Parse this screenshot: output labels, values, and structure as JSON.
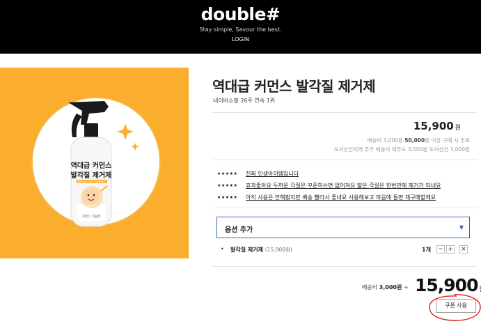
{
  "header": {
    "logo": "double#",
    "tagline": "Stay simple, Savour the best.",
    "login": "LOGIN"
  },
  "product": {
    "title": "역대급 커먼스 발각질 제거제",
    "subtitle": "네이버쇼핑 26주 연속 1위",
    "price": "15,900",
    "currency": "원",
    "image": {
      "bottle_label_line1": "역대급 커먼스",
      "bottle_label_line2": "발각질 제거제",
      "bottle_label_small": "BREAKLESS COMMONS",
      "bottle_brand": "커먼스 더블샵",
      "background_color": "#FBAE2E"
    }
  },
  "shipping": {
    "line1_prefix": "배송비 3,000원",
    "line1_bold": "50,000",
    "line1_suffix": "원 이상 구매 시 무료",
    "line2": "도서산간지역 추가 배송비 제주도 3,000원 도서산간 3,000원"
  },
  "reviews": [
    {
      "stars": "★★★★★",
      "text": "진짜 인생아이템입니다"
    },
    {
      "stars": "★★★★★",
      "text": "효과좋아요 두꺼운 각질은 꾸준히쓰면 없어져요 얇은 각질은 한번만에 제거가 되네요"
    },
    {
      "stars": "★★★★★",
      "text": "아직 사용은 안해봤지만 배송 빨라서 좋네요 사용해보고 마음에 들면 재구매할께요"
    }
  ],
  "options": {
    "select_label": "옵션 추가",
    "selected": {
      "name": "발각질 제거제",
      "price": "(15,900원)",
      "quantity": "1개",
      "minus": "−",
      "plus": "+",
      "remove": "×"
    }
  },
  "summary": {
    "shipping_label": "배송비",
    "shipping_value": "3,000원",
    "plus": "+",
    "total": "15,900",
    "currency": "원",
    "coupon_button": "쿠폰 사용"
  },
  "colors": {
    "accent_blue": "#3b63b8",
    "annotation_red": "#e0201b",
    "image_bg": "#FBAE2E"
  }
}
